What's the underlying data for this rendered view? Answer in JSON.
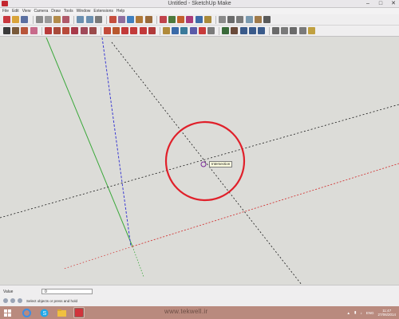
{
  "window": {
    "title": "Untitled - SketchUp Make"
  },
  "menu": {
    "items": [
      "File",
      "Edit",
      "View",
      "Camera",
      "Draw",
      "Tools",
      "Window",
      "Extensions",
      "Help"
    ]
  },
  "toolbar_row1": {
    "icons": [
      {
        "name": "new-icon",
        "color": "#c8383f"
      },
      {
        "name": "open-icon",
        "color": "#d9a43a"
      },
      {
        "name": "save-icon",
        "color": "#5b6fa0"
      },
      {
        "name": "cut-icon",
        "color": "#8a8a8a"
      },
      {
        "name": "copy-icon",
        "color": "#9a9a9a"
      },
      {
        "name": "paste-icon",
        "color": "#b38b4a"
      },
      {
        "name": "erase-icon",
        "color": "#b05a6a"
      },
      {
        "name": "undo-icon",
        "color": "#6a8fb0"
      },
      {
        "name": "redo-icon",
        "color": "#6a8fb0"
      },
      {
        "name": "print-icon",
        "color": "#7a7a7a"
      },
      {
        "name": "model-info-icon",
        "color": "#c54e3d"
      },
      {
        "name": "group-icon",
        "color": "#8f6e9e"
      },
      {
        "name": "component-icon",
        "color": "#3f7fbf"
      },
      {
        "name": "sandbox-icon",
        "color": "#b07838"
      },
      {
        "name": "solid-icon",
        "color": "#9a6a3a"
      },
      {
        "name": "iso-view-icon",
        "color": "#c0434b"
      },
      {
        "name": "top-view-icon",
        "color": "#4d7a3d"
      },
      {
        "name": "front-view-icon",
        "color": "#c25f2d"
      },
      {
        "name": "right-view-icon",
        "color": "#aa3a7a"
      },
      {
        "name": "back-view-icon",
        "color": "#3d6ba8"
      },
      {
        "name": "left-view-icon",
        "color": "#aa8a3a"
      },
      {
        "name": "xray-icon",
        "color": "#8a8a8a"
      },
      {
        "name": "wireframe-icon",
        "color": "#6a6a6a"
      },
      {
        "name": "hidden-line-icon",
        "color": "#7a7a7a"
      },
      {
        "name": "shaded-icon",
        "color": "#7a9ab0"
      },
      {
        "name": "textured-icon",
        "color": "#a07a4a"
      },
      {
        "name": "monochrome-icon",
        "color": "#5a5a5a"
      }
    ]
  },
  "toolbar_row2": {
    "icons": [
      {
        "name": "select-icon",
        "color": "#3a3a3a"
      },
      {
        "name": "make-component-icon",
        "color": "#7a5a3a"
      },
      {
        "name": "paint-bucket-icon",
        "color": "#b8553a"
      },
      {
        "name": "eraser-icon",
        "color": "#c76a8a"
      },
      {
        "name": "line-icon",
        "color": "#b83a3a"
      },
      {
        "name": "arc-icon",
        "color": "#a84a3a"
      },
      {
        "name": "rectangle-icon",
        "color": "#b84a3a"
      },
      {
        "name": "circle-icon",
        "color": "#a83a4a"
      },
      {
        "name": "polygon-icon",
        "color": "#a04a5a"
      },
      {
        "name": "freehand-icon",
        "color": "#9a4a4a"
      },
      {
        "name": "move-icon",
        "color": "#c24a3a"
      },
      {
        "name": "push-pull-icon",
        "color": "#b8582e"
      },
      {
        "name": "rotate-icon",
        "color": "#c23a3a"
      },
      {
        "name": "follow-me-icon",
        "color": "#c23a3a"
      },
      {
        "name": "scale-icon",
        "color": "#c2393a"
      },
      {
        "name": "offset-icon",
        "color": "#b03a3a"
      },
      {
        "name": "tape-measure-icon",
        "color": "#b08a3a"
      },
      {
        "name": "dimension-icon",
        "color": "#3a6aa8"
      },
      {
        "name": "protractor-icon",
        "color": "#3a7a9a"
      },
      {
        "name": "text-icon",
        "color": "#5a5aa8"
      },
      {
        "name": "axes-icon",
        "color": "#c83a3a"
      },
      {
        "name": "3d-text-icon",
        "color": "#7a7a7a"
      },
      {
        "name": "orbit-icon",
        "color": "#3a6a3a"
      },
      {
        "name": "pan-icon",
        "color": "#6a4a3a"
      },
      {
        "name": "zoom-icon",
        "color": "#3a5a8a"
      },
      {
        "name": "zoom-window-icon",
        "color": "#3a5a8a"
      },
      {
        "name": "zoom-extents-icon",
        "color": "#3a5a8a"
      },
      {
        "name": "previous-view-icon",
        "color": "#6a6a6a"
      },
      {
        "name": "position-camera-icon",
        "color": "#7a7a7a"
      },
      {
        "name": "walk-icon",
        "color": "#6a6a6a"
      },
      {
        "name": "look-around-icon",
        "color": "#7a7a7a"
      },
      {
        "name": "section-plane-icon",
        "color": "#c0a040"
      }
    ]
  },
  "canvas": {
    "tooltip": "Intersection",
    "colors": {
      "red_axis": "#d23a3a",
      "green_axis": "#3aa83a",
      "blue_axis": "#3a3ad2",
      "black_guide": "#1a1a1a",
      "highlight_circle": "#e0202a"
    }
  },
  "status": {
    "measure_label": "Value",
    "measure_value": "0",
    "hint": "Select objects or press and hold"
  },
  "taskbar": {
    "watermark": "www.tekwell.ir",
    "lang": "ENG",
    "time": "11:47",
    "date": "27/06/2014"
  }
}
